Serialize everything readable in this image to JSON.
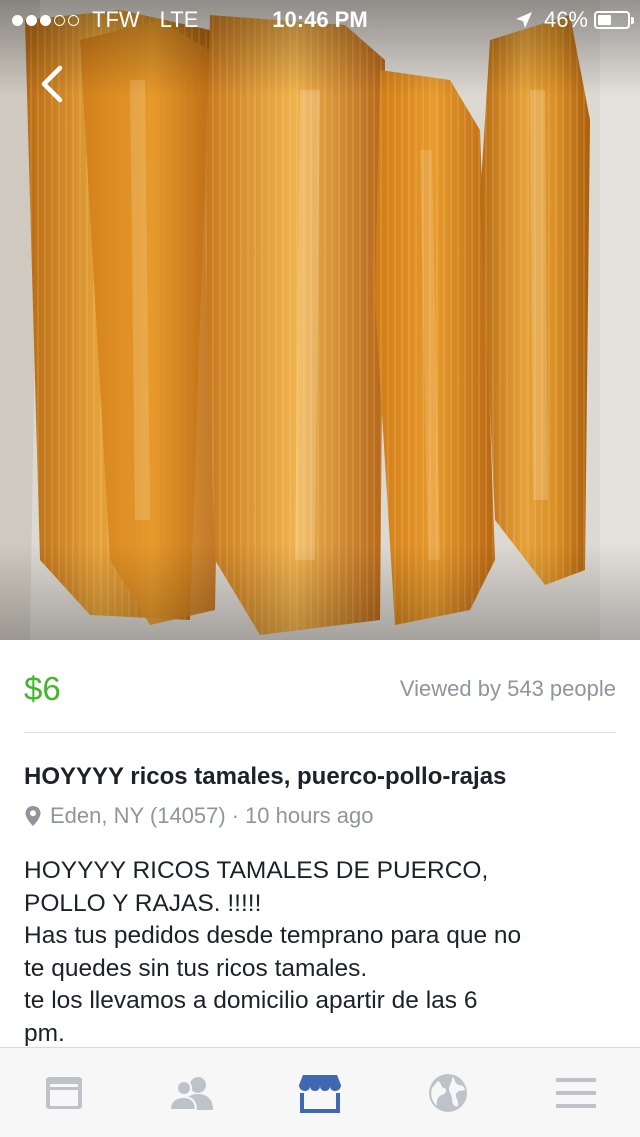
{
  "status_bar": {
    "signal_dots": [
      true,
      true,
      true,
      false,
      false
    ],
    "carrier": "TFW",
    "network": "LTE",
    "time": "10:46 PM",
    "battery_percent": "46%",
    "battery_level": 0.46
  },
  "listing": {
    "price": "$6",
    "views": "Viewed by 543 people",
    "title": "HOYYYY ricos tamales, puerco-pollo-rajas",
    "location": "Eden, NY (14057)",
    "separator": "·",
    "posted": "10 hours ago",
    "description_lines": [
      "HOYYYY RICOS TAMALES DE PUERCO,",
      "POLLO Y RAJAS. !!!!!",
      "Has tus pedidos desde temprano para que no",
      "te quedes sin tus ricos tamales.",
      "te los llevamos a domicilio apartir de las 6",
      "pm."
    ]
  },
  "tabs": [
    {
      "icon": "news-feed-icon",
      "active": false
    },
    {
      "icon": "friends-icon",
      "active": false
    },
    {
      "icon": "marketplace-icon",
      "active": true
    },
    {
      "icon": "globe-icon",
      "active": false
    },
    {
      "icon": "menu-icon",
      "active": false
    }
  ],
  "colors": {
    "price": "#42b72a",
    "muted": "#90949c",
    "text": "#1d2129",
    "active_tab": "#4267b2",
    "inactive_tab": "#bec3c9"
  }
}
